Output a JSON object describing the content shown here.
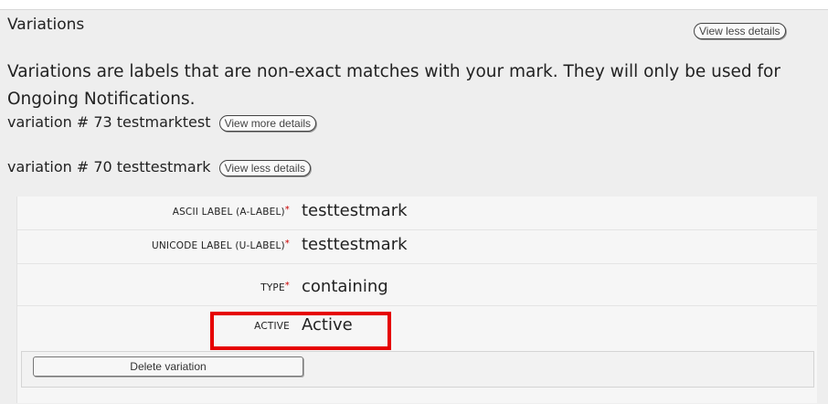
{
  "section": {
    "title": "Variations",
    "view_less_top": "View less details",
    "description": "Variations are labels that are non-exact matches with your mark. They will only be used for Ongoing Notifications."
  },
  "variations": [
    {
      "label": "variation # 73 testmarktest",
      "button": "View more details"
    },
    {
      "label": "variation # 70 testtestmark",
      "button": "View less details"
    }
  ],
  "details": {
    "fields": [
      {
        "label": "ASCII LABEL (A-LABEL)",
        "required": "*",
        "value": "testtestmark"
      },
      {
        "label": "UNICODE LABEL (U-LABEL)",
        "required": "*",
        "value": "testtestmark"
      },
      {
        "label": "TYPE",
        "required": "*",
        "value": "containing"
      },
      {
        "label": "ACTIVE",
        "required": "",
        "value": "Active"
      }
    ],
    "delete_button": "Delete variation"
  },
  "colors": {
    "panel_bg": "#eeeeee",
    "highlight": "#e60000",
    "required": "#cc0000"
  }
}
